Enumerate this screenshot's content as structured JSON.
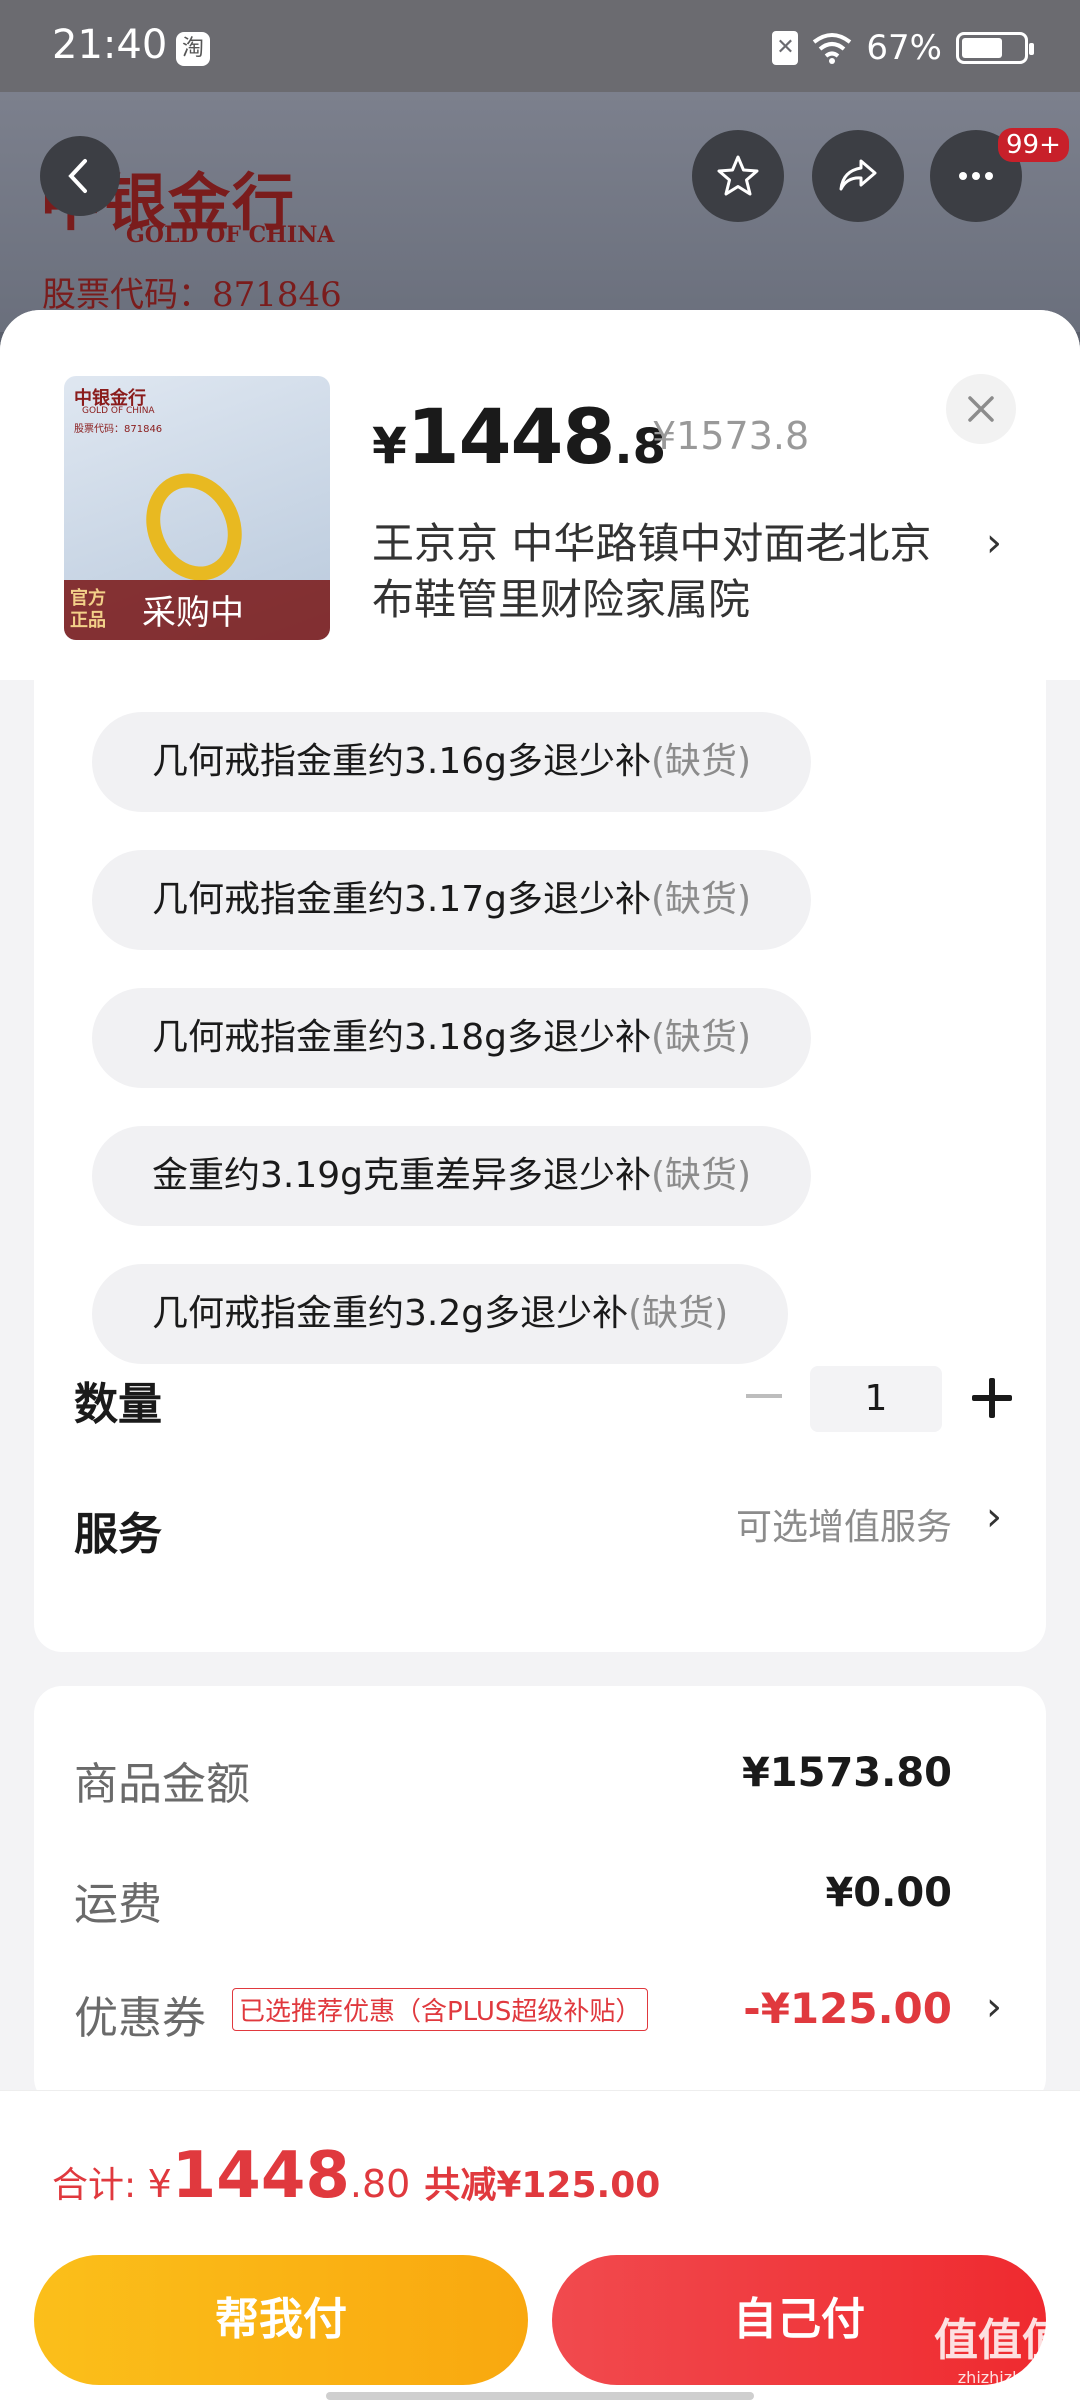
{
  "status_bar": {
    "time": "21:40",
    "app_icon_text": "淘",
    "battery": "67%",
    "battery_level": 0.67
  },
  "background_page": {
    "logo_text": "中银金行",
    "logo_en": "GOLD OF CHINA",
    "stock_code": "股票代码：871846",
    "badge": "99+"
  },
  "product": {
    "thumb_logo": "中银金行",
    "thumb_logo_en": "GOLD OF CHINA",
    "thumb_code": "股票代码：871846",
    "official_tag": "官方\n正品",
    "buying_tag": "采购中",
    "price_symbol": "¥",
    "price_int": "1448",
    "price_dec": ".8",
    "price_original": "¥1573.8",
    "address": "王京京  中华路镇中对面老北京布鞋管里财险家属院",
    "address_chevron": "›"
  },
  "variants": [
    {
      "label": "几何戒指金重约3.16g多退少补",
      "status": "(缺货)"
    },
    {
      "label": "几何戒指金重约3.17g多退少补",
      "status": "(缺货)"
    },
    {
      "label": "几何戒指金重约3.18g多退少补",
      "status": "(缺货)"
    },
    {
      "label": "金重约3.19g克重差异多退少补",
      "status": "(缺货)"
    },
    {
      "label": "几何戒指金重约3.2g多退少补",
      "status": "(缺货)"
    }
  ],
  "quantity": {
    "label": "数量",
    "value": "1"
  },
  "service": {
    "label": "服务",
    "value": "可选增值服务",
    "chevron": "›"
  },
  "summary": {
    "goods_label": "商品金额",
    "goods_value": "¥1573.80",
    "shipping_label": "运费",
    "shipping_value": "¥0.00",
    "coupon_label": "优惠券",
    "coupon_tag": "已选推荐优惠（含PLUS超级补贴）",
    "coupon_value": "-¥125.00",
    "coupon_chevron": "›"
  },
  "footer": {
    "total_label": "合计: ",
    "total_symbol": "¥",
    "total_int": "1448",
    "total_dec": ".80",
    "saved": "共减¥125.00",
    "help_pay": "帮我付",
    "self_pay": "自己付"
  },
  "watermark": {
    "text": "值值值",
    "sub": "zhizhizhi.com"
  },
  "colors": {
    "accent_red": "#e0393e",
    "help_btn": "#fbbf1a",
    "self_btn": "#ef2a2f"
  }
}
